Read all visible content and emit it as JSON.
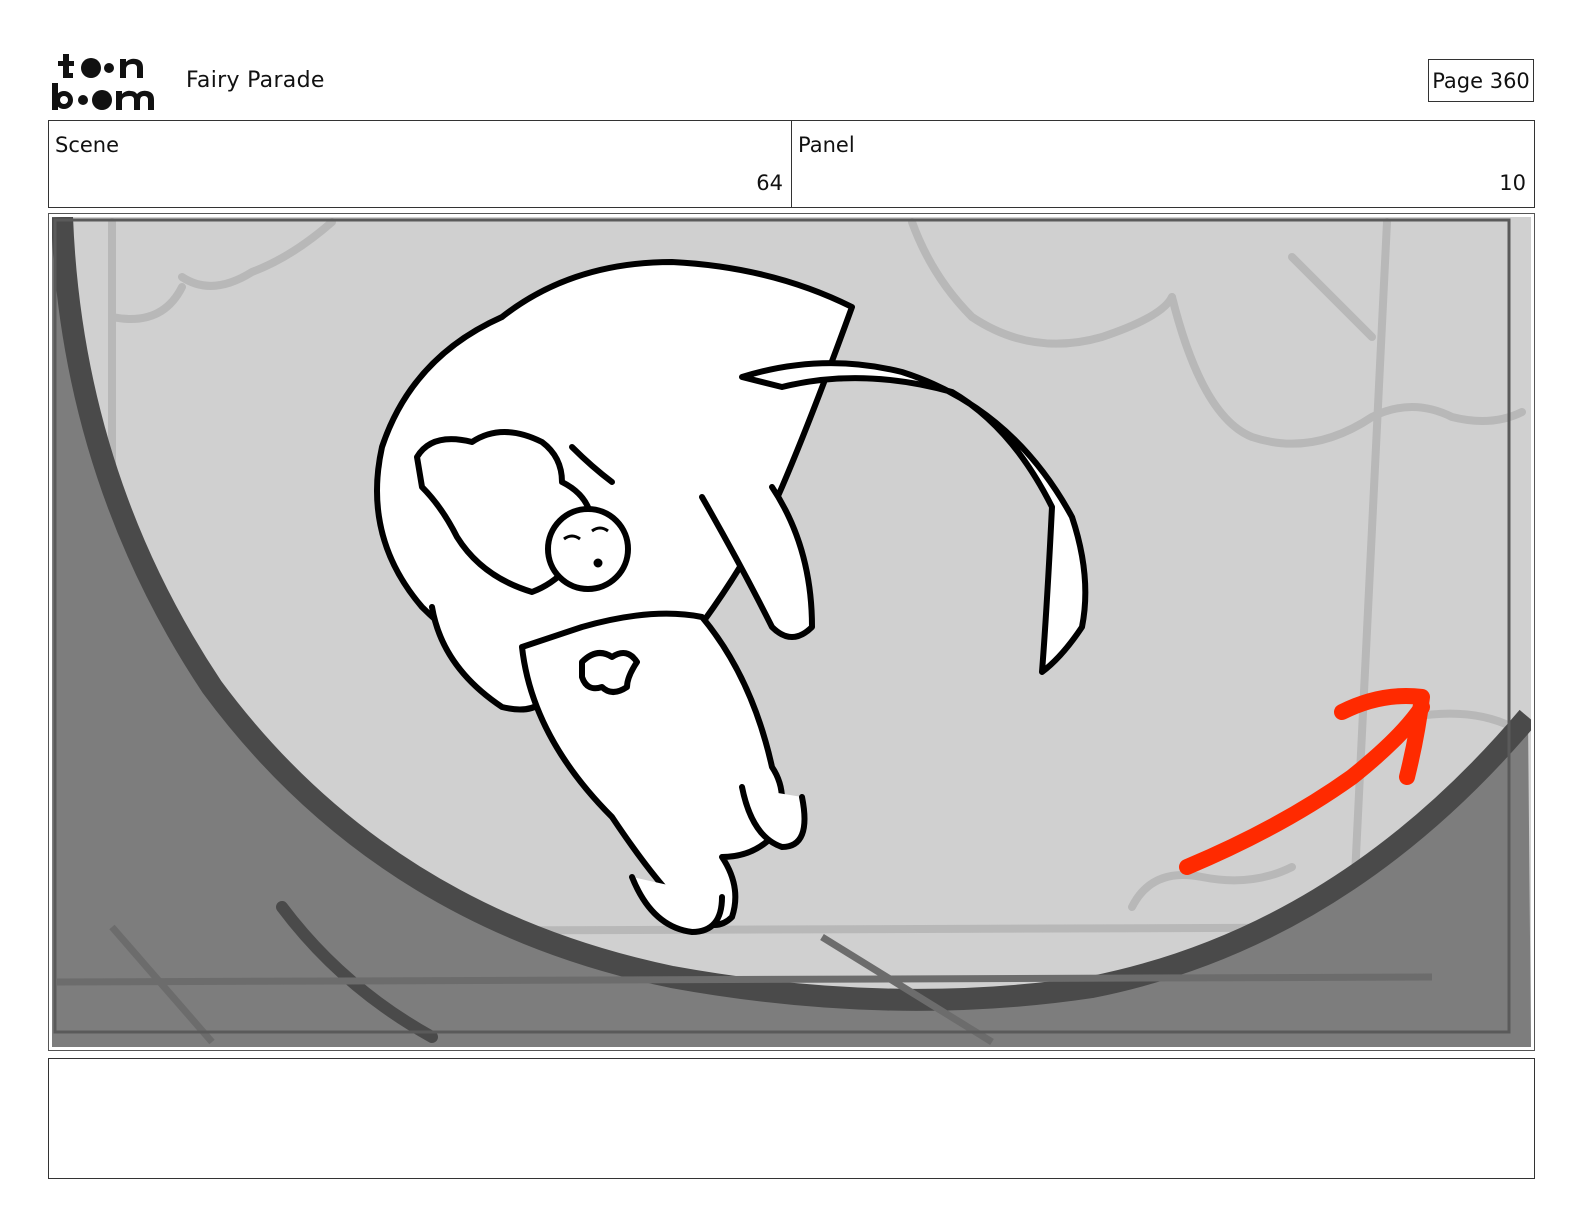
{
  "header": {
    "logo": {
      "line1": "toon",
      "line2": "boom",
      "icon": "toon-boom-logo"
    },
    "project_title": "Fairy Parade",
    "page_label": "Page 360"
  },
  "info": {
    "scene_label": "Scene",
    "scene_value": "64",
    "panel_label": "Panel",
    "panel_value": "10"
  },
  "panel": {
    "description_icons": [
      "flying-creature-with-rider",
      "motion-arrow"
    ],
    "colors": {
      "background": "#d0d0d0",
      "vignette": "#7d7d7d",
      "arrow": "#ff2a00",
      "ink": "#000000"
    }
  },
  "notes": {
    "text": ""
  }
}
